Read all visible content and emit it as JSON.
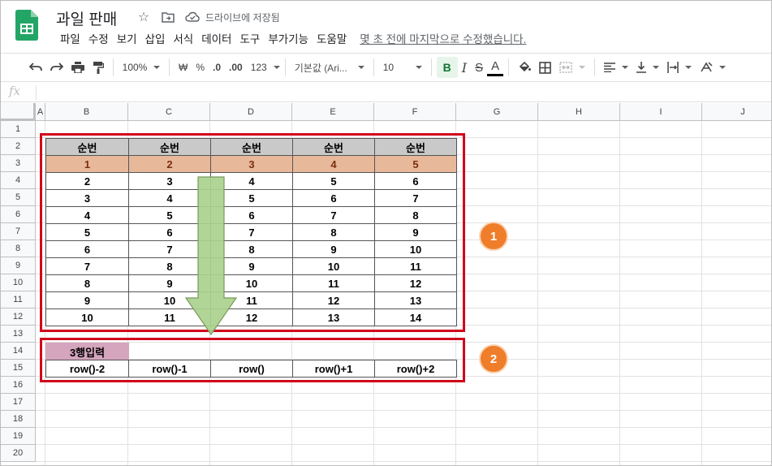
{
  "header": {
    "title": "과일 판매",
    "saved_status": "드라이브에 저장됨",
    "menu": [
      "파일",
      "수정",
      "보기",
      "삽입",
      "서식",
      "데이터",
      "도구",
      "부가기능",
      "도움말"
    ],
    "last_edit": "몇 초 전에 마지막으로 수정했습니다."
  },
  "toolbar": {
    "zoom": "100%",
    "currency": "₩",
    "percent": "%",
    "dec_less": ".0",
    "dec_more": ".00",
    "format_more": "123",
    "font": "기본값 (Ari...",
    "font_size": "10",
    "bold": "B",
    "italic": "I",
    "strike": "S",
    "text_color": "A"
  },
  "formula_bar": {
    "fx": "fx",
    "value": ""
  },
  "columns": [
    "A",
    "B",
    "C",
    "D",
    "E",
    "F",
    "G",
    "H",
    "I",
    "J"
  ],
  "rows": [
    "1",
    "2",
    "3",
    "4",
    "5",
    "6",
    "7",
    "8",
    "9",
    "10",
    "11",
    "12",
    "13",
    "14",
    "15",
    "16",
    "17",
    "18",
    "19",
    "20"
  ],
  "table1": {
    "headers": [
      "순번",
      "순번",
      "순번",
      "순번",
      "순번"
    ],
    "rows": [
      [
        "1",
        "2",
        "3",
        "4",
        "5"
      ],
      [
        "2",
        "3",
        "4",
        "5",
        "6"
      ],
      [
        "3",
        "4",
        "5",
        "6",
        "7"
      ],
      [
        "4",
        "5",
        "6",
        "7",
        "8"
      ],
      [
        "5",
        "6",
        "7",
        "8",
        "9"
      ],
      [
        "6",
        "7",
        "8",
        "9",
        "10"
      ],
      [
        "7",
        "8",
        "9",
        "10",
        "11"
      ],
      [
        "8",
        "9",
        "10",
        "11",
        "12"
      ],
      [
        "9",
        "10",
        "11",
        "12",
        "13"
      ],
      [
        "10",
        "11",
        "12",
        "13",
        "14"
      ]
    ]
  },
  "table2": {
    "label": "3행입력",
    "formulas": [
      "row()-2",
      "row()-1",
      "row()",
      "row()+1",
      "row()+2"
    ]
  },
  "badges": [
    "1",
    "2"
  ],
  "colors": {
    "highlight_row": "#e8b89b",
    "header_fill": "#c9c9c9",
    "label_fill": "#d4a5bd",
    "red_box": "#d0021b",
    "badge": "#ef7d2a",
    "arrow": "#a9d18e"
  }
}
